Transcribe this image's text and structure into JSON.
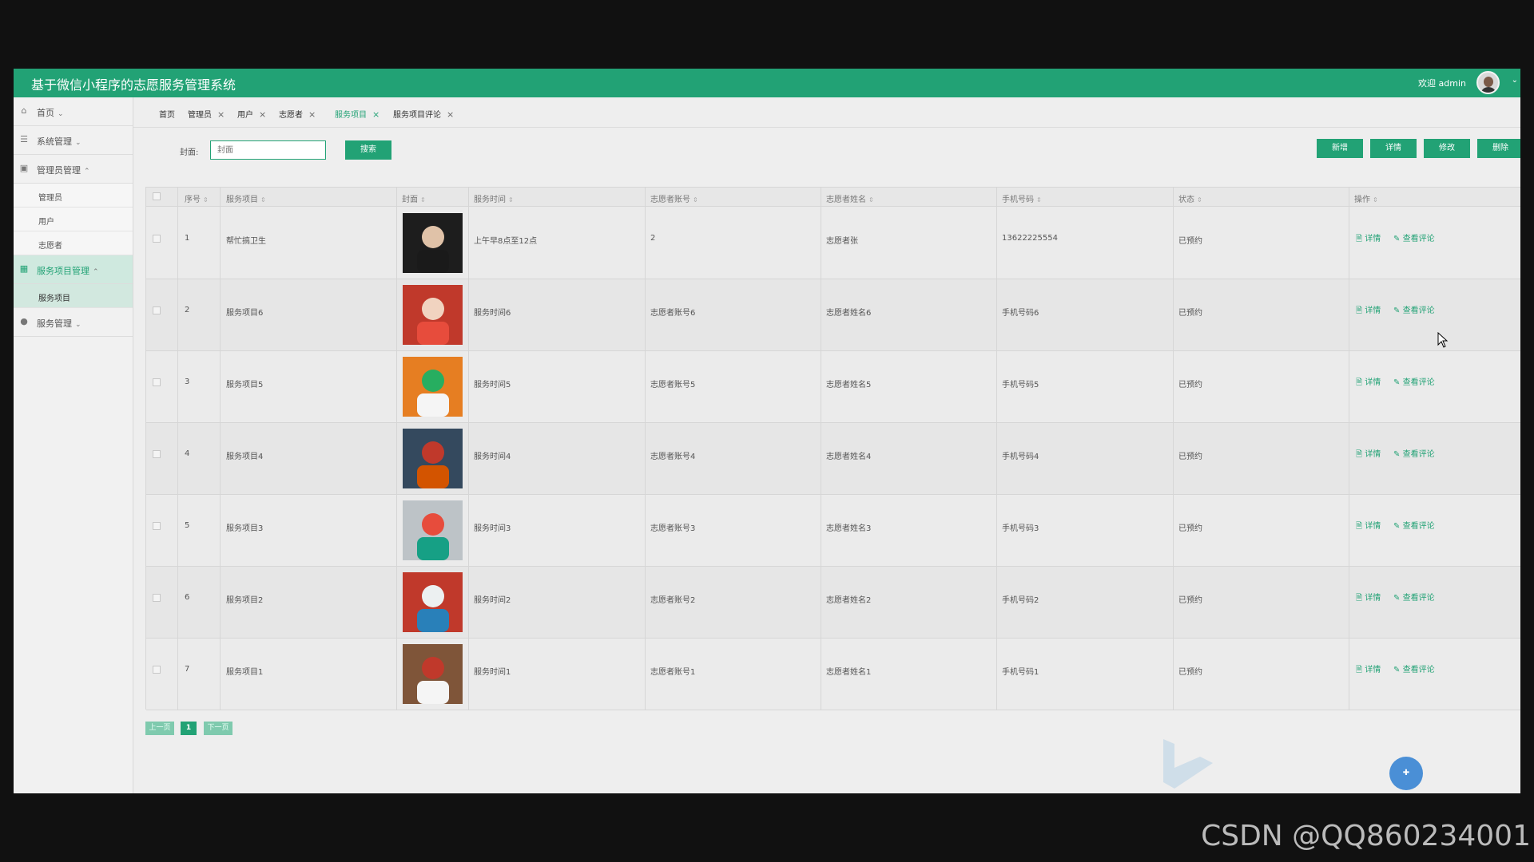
{
  "header": {
    "title": "基于微信小程序的志愿服务管理系统",
    "welcome": "欢迎 admin"
  },
  "sidebar": {
    "groups": [
      {
        "label": "首页",
        "icon": "home-icon",
        "caret": "⌄"
      },
      {
        "label": "系统管理",
        "icon": "server-icon",
        "caret": "⌄"
      },
      {
        "label": "管理员管理",
        "icon": "briefcase-icon",
        "caret": "⌃"
      },
      {
        "label": "服务项目管理",
        "icon": "grid-icon",
        "caret": "⌃"
      },
      {
        "label": "服务管理",
        "icon": "circle-icon",
        "caret": "⌄"
      }
    ],
    "admin_items": [
      "管理员",
      "用户",
      "志愿者"
    ],
    "service_items": [
      "服务项目"
    ]
  },
  "tabs": [
    {
      "label": "首页",
      "closable": false
    },
    {
      "label": "管理员",
      "closable": true
    },
    {
      "label": "用户",
      "closable": true
    },
    {
      "label": "志愿者",
      "closable": true
    },
    {
      "label": "服务项目",
      "closable": true,
      "active": true
    },
    {
      "label": "服务项目评论",
      "closable": true
    }
  ],
  "search": {
    "label": "封面:",
    "placeholder": "封面",
    "button": "搜索"
  },
  "toolbar": {
    "add": "新增",
    "detail": "详情",
    "edit": "修改",
    "delete": "删除"
  },
  "table": {
    "headers": [
      "序号",
      "服务项目",
      "封面",
      "服务时间",
      "志愿者账号",
      "志愿者姓名",
      "手机号码",
      "状态",
      "操作"
    ],
    "rows": [
      {
        "no": "1",
        "project": "帮忙搞卫生",
        "time": "上午早8点至12点",
        "account": "2",
        "name": "志愿者张",
        "phone": "13622225554",
        "status": "已预约"
      },
      {
        "no": "2",
        "project": "服务项目6",
        "time": "服务时间6",
        "account": "志愿者账号6",
        "name": "志愿者姓名6",
        "phone": "手机号码6",
        "status": "已预约"
      },
      {
        "no": "3",
        "project": "服务项目5",
        "time": "服务时间5",
        "account": "志愿者账号5",
        "name": "志愿者姓名5",
        "phone": "手机号码5",
        "status": "已预约"
      },
      {
        "no": "4",
        "project": "服务项目4",
        "time": "服务时间4",
        "account": "志愿者账号4",
        "name": "志愿者姓名4",
        "phone": "手机号码4",
        "status": "已预约"
      },
      {
        "no": "5",
        "project": "服务项目3",
        "time": "服务时间3",
        "account": "志愿者账号3",
        "name": "志愿者姓名3",
        "phone": "手机号码3",
        "status": "已预约"
      },
      {
        "no": "6",
        "project": "服务项目2",
        "time": "服务时间2",
        "account": "志愿者账号2",
        "name": "志愿者姓名2",
        "phone": "手机号码2",
        "status": "已预约"
      },
      {
        "no": "7",
        "project": "服务项目1",
        "time": "服务时间1",
        "account": "志愿者账号1",
        "name": "志愿者姓名1",
        "phone": "手机号码1",
        "status": "已预约"
      }
    ],
    "actions": {
      "detail": "详情",
      "comments": "查看评论"
    }
  },
  "pagination": {
    "prev": "上一页",
    "current": "1",
    "next": "下一页"
  },
  "watermark": "CSDN @QQ860234001",
  "colors": {
    "accent": "#22a275",
    "background": "#eeeeee",
    "frame": "#111111"
  }
}
